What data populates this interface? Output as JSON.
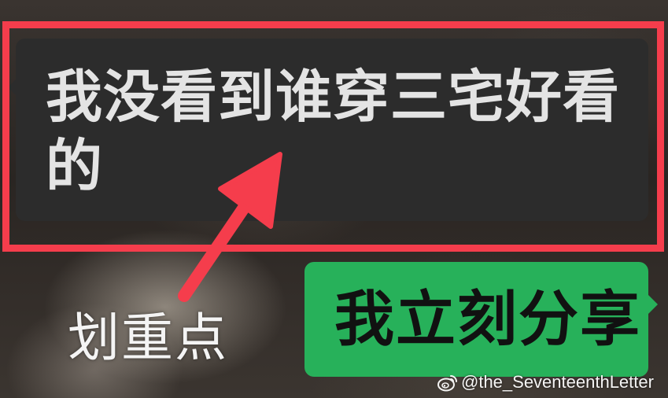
{
  "chat": {
    "incoming_message": "我没看到谁穿三宅好看的",
    "outgoing_message": "我立刻分享"
  },
  "annotation": {
    "label": "划重点"
  },
  "watermark": {
    "icon": "weibo-icon",
    "text": "@the_SeventeenthLetter"
  },
  "colors": {
    "highlight_frame": "#f53d4c",
    "arrow": "#f53d4c",
    "incoming_bubble": "#2c2c2c",
    "incoming_text": "#e4e4e4",
    "outgoing_bubble": "#27b15a",
    "outgoing_text": "#111111"
  }
}
